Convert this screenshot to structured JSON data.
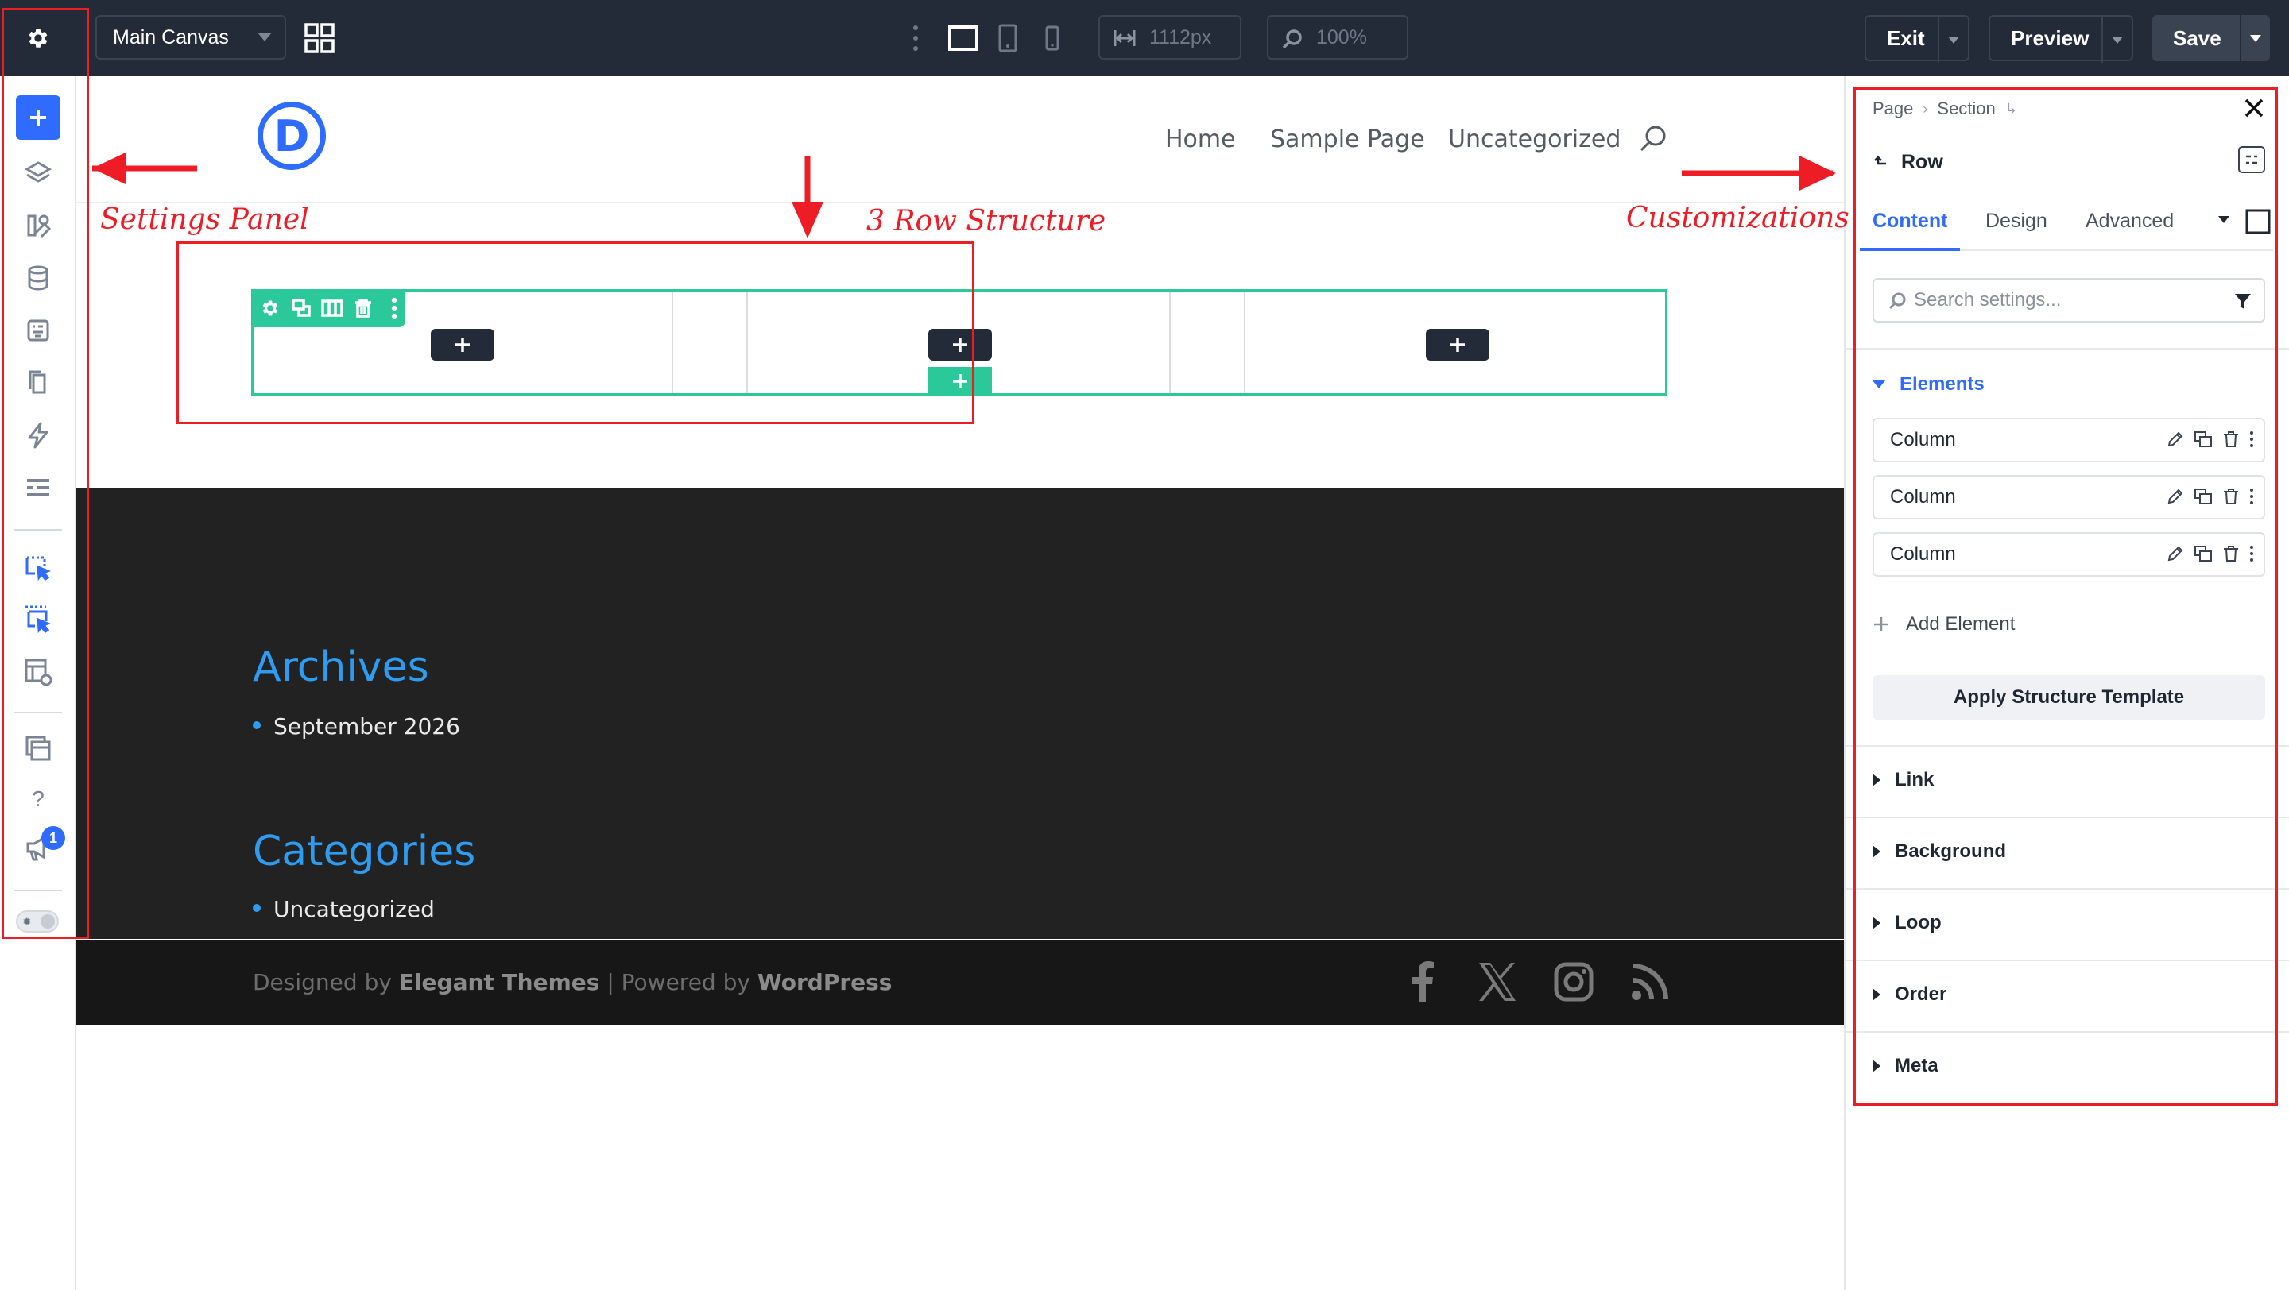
{
  "topbar": {
    "canvas_name": "Main Canvas",
    "width_value": "1112px",
    "zoom_value": "100%",
    "exit_label": "Exit",
    "preview_label": "Preview",
    "save_label": "Save",
    "colors": {
      "bar": "#232b38",
      "accent": "#2f6bff"
    }
  },
  "leftrail": {
    "icons": [
      "add-icon",
      "layers-icon",
      "modules-icon",
      "database-icon",
      "pages-icon",
      "copy-icon",
      "bolt-icon",
      "list-icon",
      "select-icon",
      "multi-select-icon",
      "layout-settings-icon",
      "panels-icon",
      "help-icon",
      "announcement-icon"
    ],
    "help_glyph": "?",
    "notification_count": "1"
  },
  "site": {
    "logo_letter": "D",
    "nav": [
      "Home",
      "Sample Page",
      "Uncategorized"
    ],
    "widgets": [
      {
        "title": "Archives",
        "items": [
          "September 2026"
        ]
      },
      {
        "title": "Categories",
        "items": [
          "Uncategorized"
        ]
      }
    ],
    "credits": {
      "designed_by": "Designed by",
      "theme_name": "Elegant Themes",
      "sep": "| Powered by",
      "platform": "WordPress"
    },
    "colors": {
      "row_outline": "#2bc89a",
      "widget_title": "#2e9cf0",
      "footer": "#222222"
    }
  },
  "panel": {
    "breadcrumb": [
      "Page",
      "Section"
    ],
    "breadcrumb_sep": "›",
    "breadcrumb_tail": "↳",
    "element_title": "Row",
    "tabs": [
      "Content",
      "Design",
      "Advanced"
    ],
    "search_placeholder": "Search settings...",
    "elements_group": "Elements",
    "elements": [
      "Column",
      "Column",
      "Column"
    ],
    "add_element": "Add Element",
    "apply_template": "Apply Structure Template",
    "groups": [
      "Link",
      "Background",
      "Loop",
      "Order",
      "Meta"
    ]
  },
  "annotations": {
    "settings_panel": "Settings Panel",
    "row_structure": "3 Row Structure",
    "customizations": "Customizations",
    "color": "#ee1c25"
  }
}
